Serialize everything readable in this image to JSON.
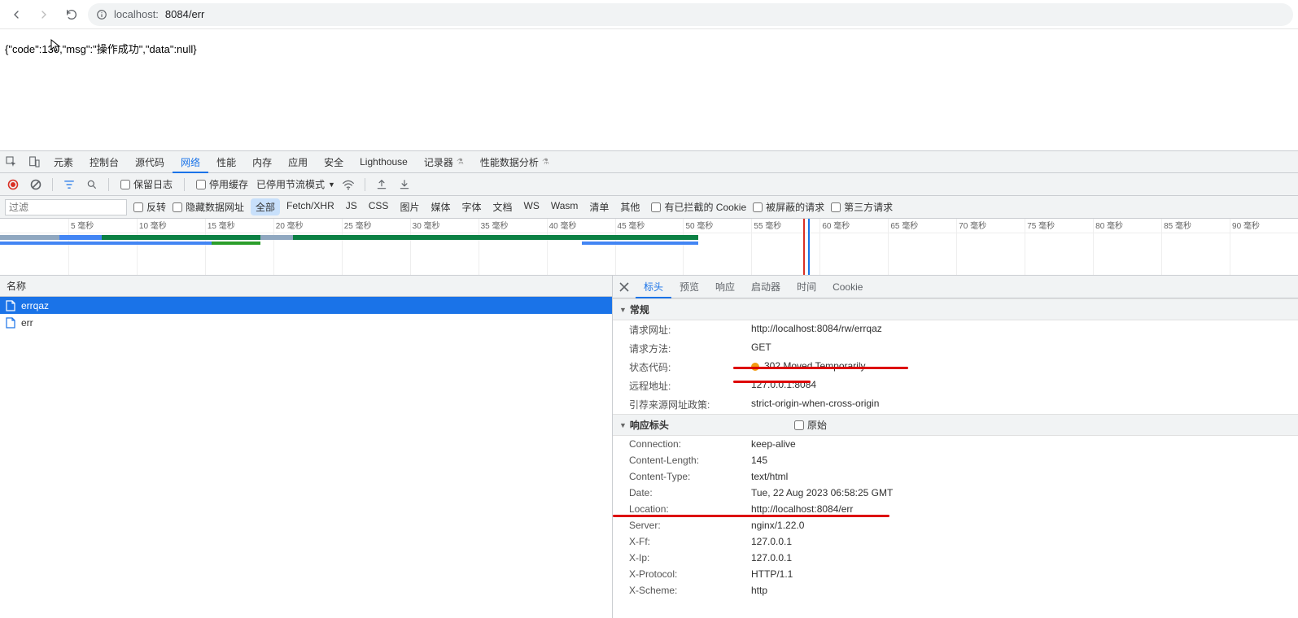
{
  "browser": {
    "url_host": "localhost:",
    "url_port_path": "8084/err"
  },
  "page_body": "{\"code\":130,\"msg\":\"操作成功\",\"data\":null}",
  "devtools_tabs": [
    "元素",
    "控制台",
    "源代码",
    "网络",
    "性能",
    "内存",
    "应用",
    "安全",
    "Lighthouse",
    "记录器",
    "性能数据分析"
  ],
  "devtools_active_tab": "网络",
  "net_toolbar": {
    "preserve_log": "保留日志",
    "disable_cache": "停用缓存",
    "throttling": "已停用节流模式"
  },
  "filter": {
    "placeholder": "过滤",
    "invert": "反转",
    "hide_data_urls": "隐藏数据网址",
    "types": [
      "全部",
      "Fetch/XHR",
      "JS",
      "CSS",
      "图片",
      "媒体",
      "字体",
      "文档",
      "WS",
      "Wasm",
      "清单",
      "其他"
    ],
    "type_active": "全部",
    "blocked_cookies": "有已拦截的 Cookie",
    "blocked_requests": "被屏蔽的请求",
    "third_party": "第三方请求"
  },
  "timeline_ticks": [
    "5 毫秒",
    "10 毫秒",
    "15 毫秒",
    "20 毫秒",
    "25 毫秒",
    "30 毫秒",
    "35 毫秒",
    "40 毫秒",
    "45 毫秒",
    "50 毫秒",
    "55 毫秒",
    "60 毫秒",
    "65 毫秒",
    "70 毫秒",
    "75 毫秒",
    "80 毫秒",
    "85 毫秒",
    "90 毫秒"
  ],
  "name_col": "名称",
  "requests": [
    {
      "name": "errqaz",
      "selected": true
    },
    {
      "name": "err",
      "selected": false
    }
  ],
  "detail_tabs": [
    "标头",
    "预览",
    "响应",
    "启动器",
    "时间",
    "Cookie"
  ],
  "detail_active_tab": "标头",
  "sections": {
    "general_title": "常规",
    "general": [
      {
        "k": "请求网址:",
        "v": "http://localhost:8084/rw/errqaz"
      },
      {
        "k": "请求方法:",
        "v": "GET"
      },
      {
        "k": "状态代码:",
        "v": "302 Moved Temporarily",
        "status_color": "#f39c12"
      },
      {
        "k": "远程地址:",
        "v": "127.0.0.1:8084"
      },
      {
        "k": "引荐来源网址政策:",
        "v": "strict-origin-when-cross-origin"
      }
    ],
    "resp_title": "响应标头",
    "raw_label": "原始",
    "response_headers": [
      {
        "k": "Connection:",
        "v": "keep-alive"
      },
      {
        "k": "Content-Length:",
        "v": "145"
      },
      {
        "k": "Content-Type:",
        "v": "text/html"
      },
      {
        "k": "Date:",
        "v": "Tue, 22 Aug 2023 06:58:25 GMT"
      },
      {
        "k": "Location:",
        "v": "http://localhost:8084/err"
      },
      {
        "k": "Server:",
        "v": "nginx/1.22.0"
      },
      {
        "k": "X-Ff:",
        "v": "127.0.0.1"
      },
      {
        "k": "X-Ip:",
        "v": "127.0.0.1"
      },
      {
        "k": "X-Protocol:",
        "v": "HTTP/1.1"
      },
      {
        "k": "X-Scheme:",
        "v": "http"
      }
    ]
  }
}
